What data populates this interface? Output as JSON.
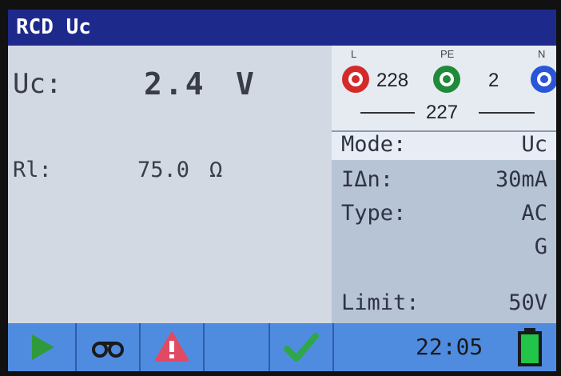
{
  "title": "RCD Uc",
  "results": {
    "uc_label": "Uc:",
    "uc_value": "2.4",
    "uc_unit": "V",
    "rl_label": "Rl:",
    "rl_value": "75.0",
    "rl_unit": "Ω"
  },
  "terminals": {
    "l_label": "L",
    "pe_label": "PE",
    "n_label": "N",
    "l_pe_voltage": "228",
    "pe_n_voltage": "2",
    "l_n_voltage": "227",
    "l_color": "#d42a2a",
    "pe_color": "#1f8a3a",
    "n_color": "#2a55d8"
  },
  "params": [
    {
      "key": "Mode:",
      "value": "Uc"
    },
    {
      "key": "IΔn:",
      "value": "30mA"
    },
    {
      "key": "Type:",
      "value": "AC"
    },
    {
      "key": "",
      "value": "G"
    }
  ],
  "limit": {
    "key": "Limit:",
    "value": "50V"
  },
  "toolbar": {
    "start_icon": "play-icon",
    "probe_icon": "probe-icon",
    "warning_icon": "warning-icon",
    "pass_icon": "check-icon",
    "time": "22:05",
    "battery_level": 1.0
  }
}
